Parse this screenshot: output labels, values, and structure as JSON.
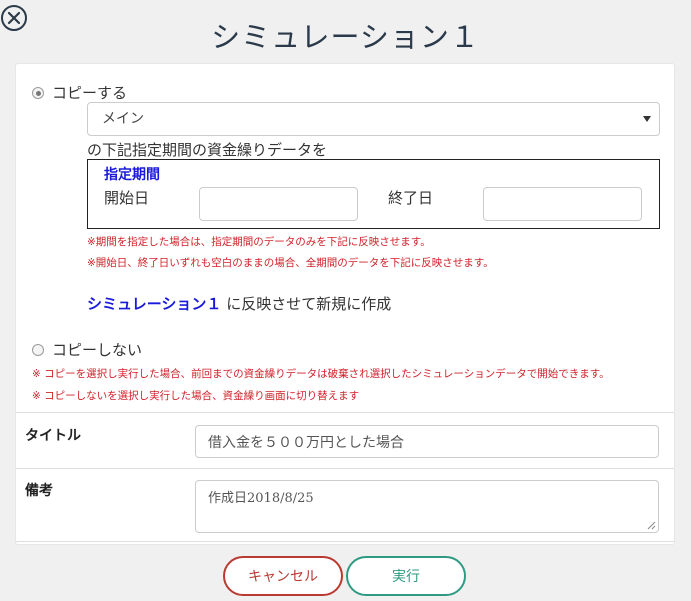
{
  "modal": {
    "title": "シミュレーション１"
  },
  "copy_option": {
    "label": "コピーする",
    "selected": true,
    "source_select": {
      "value": "メイン"
    },
    "description": "の下記指定期間の資金繰りデータを",
    "period": {
      "heading": "指定期間",
      "start_label": "開始日",
      "start_value": "",
      "end_label": "終了日",
      "end_value": ""
    },
    "notes": [
      "※期間を指定した場合は、指定期間のデータのみを下記に反映させます。",
      "※開始日、終了日いずれも空白のままの場合、全期間のデータを下記に反映させます。"
    ],
    "target_name": "シミュレーション１",
    "target_suffix": "に反映させて新規に作成"
  },
  "no_copy_option": {
    "label": "コピーしない",
    "selected": false,
    "notes": [
      "※ コピーを選択し実行した場合、前回までの資金繰りデータは破棄され選択したシミュレーションデータで開始できます。",
      "※ コピーしないを選択し実行した場合、資金繰り画面に切り替えます"
    ]
  },
  "form": {
    "title_label": "タイトル",
    "title_value": "借入金を５００万円とした場合",
    "remarks_label": "備考",
    "remarks_value": "作成日2018/8/25"
  },
  "buttons": {
    "cancel": "キャンセル",
    "execute": "実行"
  },
  "colors": {
    "title_text": "#2b3a4a",
    "accent_blue": "#1a1adb",
    "note_red": "#d0222a",
    "cancel": "#b83a30",
    "execute": "#2e9a82"
  },
  "icons": {
    "close": "close-icon",
    "dropdown": "chevron-down-icon"
  }
}
